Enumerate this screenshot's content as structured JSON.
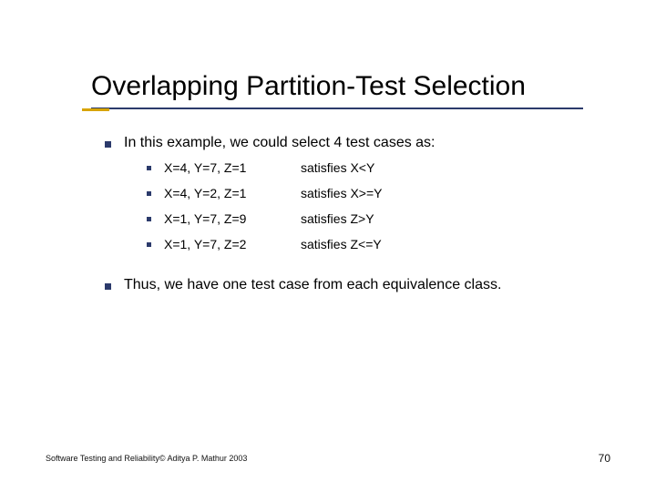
{
  "title": "Overlapping Partition-Test Selection",
  "intro": "In this example, we could select 4 test cases as:",
  "cases": [
    {
      "values": "X=4, Y=7, Z=1",
      "condition": "satisfies X<Y"
    },
    {
      "values": "X=4, Y=2, Z=1",
      "condition": "satisfies X>=Y"
    },
    {
      "values": "X=1, Y=7, Z=9",
      "condition": "satisfies Z>Y"
    },
    {
      "values": "X=1, Y=7, Z=2",
      "condition": "satisfies Z<=Y"
    }
  ],
  "conclusion": "Thus, we have one test case from each equivalence class.",
  "footer_left": "Software Testing and Reliability© Aditya P. Mathur 2003",
  "page_number": "70"
}
